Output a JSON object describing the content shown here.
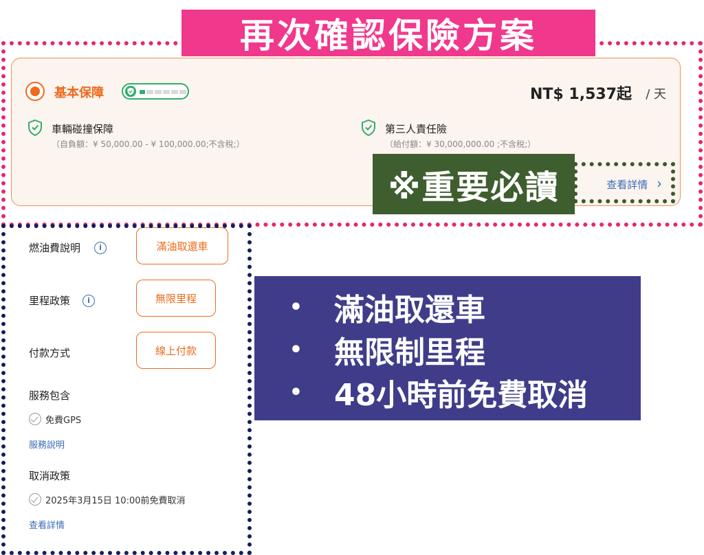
{
  "banner": {
    "title": "再次確認保險方案"
  },
  "plan": {
    "name": "基本保障",
    "price": "NT$ 1,537起",
    "per_day": "/ 天",
    "level": {
      "filled": 1,
      "total": 6
    },
    "coverages": [
      {
        "title": "車輛碰撞保障",
        "desc": "（自負額：¥ 50,000.00 - ¥ 100,000.00;不含稅;）"
      },
      {
        "title": "第三人責任險",
        "desc": "（給付額：¥ 30,000,000.00 ;不含稅;）"
      }
    ],
    "details_link": "查看詳情",
    "chevron": "›"
  },
  "important_badge": "※重要必讀",
  "policies": {
    "fuel": {
      "label": "燃油費說明",
      "value": "滿油取還車"
    },
    "mileage": {
      "label": "里程政策",
      "value": "無限里程"
    },
    "payment": {
      "label": "付款方式",
      "value": "線上付款"
    },
    "services": {
      "label": "服務包含",
      "item": "免費GPS",
      "link": "服務說明"
    },
    "cancel": {
      "label": "取消政策",
      "item": "2025年3月15日 10:00前免費取消",
      "link": "查看詳情"
    }
  },
  "info_glyph": "i",
  "summary": {
    "bullet": "•",
    "items": [
      "滿油取還車",
      "無限制里程",
      "48小時前免費取消"
    ]
  },
  "colors": {
    "accent": "#ee6a1d",
    "green": "#2fae6a",
    "link": "#3c6bb5"
  }
}
